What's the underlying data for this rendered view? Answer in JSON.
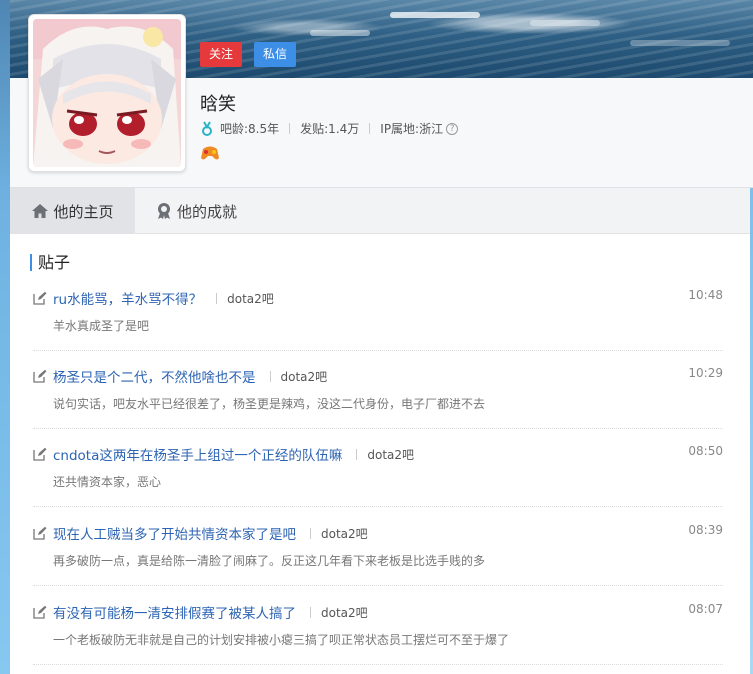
{
  "user": {
    "name": "晗笑",
    "follow_label": "关注",
    "message_label": "私信",
    "bar_age": "吧龄:8.5年",
    "posts": "发贴:1.4万",
    "ip_location": "IP属地:浙江",
    "help_glyph": "?"
  },
  "tabs": [
    {
      "label": "他的主页"
    },
    {
      "label": "他的成就"
    }
  ],
  "section_title": "贴子",
  "posts": [
    {
      "title": "ru水能骂，羊水骂不得？",
      "forum": "dota2吧",
      "time": "10:48",
      "desc": "羊水真成圣了是吧"
    },
    {
      "title": "杨圣只是个二代，不然他啥也不是",
      "forum": "dota2吧",
      "time": "10:29",
      "desc": "说句实话，吧友水平已经很差了，杨圣更是辣鸡，没这二代身份，电子厂都进不去"
    },
    {
      "title": "cndota这两年在杨圣手上组过一个正经的队伍嘛",
      "forum": "dota2吧",
      "time": "08:50",
      "desc": "还共情资本家，恶心"
    },
    {
      "title": "现在人工贼当多了开始共情资本家了是吧",
      "forum": "dota2吧",
      "time": "08:39",
      "desc": "再多破防一点，真是给陈一清脸了闹麻了。反正这几年看下来老板是比选手贱的多"
    },
    {
      "title": "有没有可能杨一清安排假赛了被某人搞了",
      "forum": "dota2吧",
      "time": "08:07",
      "desc": "一个老板破防无非就是自己的计划安排被小瘪三搞了呗正常状态员工摆烂可不至于爆了"
    }
  ],
  "colors": {
    "follow": "#e5393b",
    "message": "#3d8ee6",
    "link": "#2d64b3"
  }
}
